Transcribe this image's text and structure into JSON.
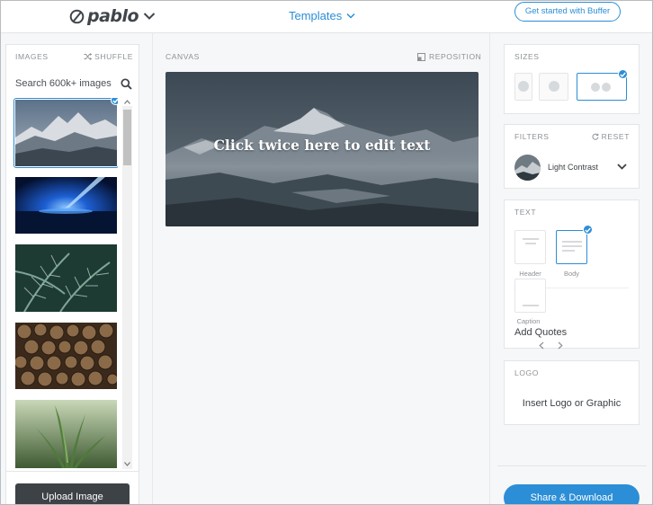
{
  "header": {
    "logo_text": "pablo",
    "templates_label": "Templates",
    "get_started_label": "Get started with Buffer"
  },
  "left_panel": {
    "images_label": "IMAGES",
    "shuffle_label": "SHUFFLE",
    "search_placeholder": "Search 600k+ images",
    "thumbnails": [
      {
        "subject": "snowy mountain peaks above clouds",
        "selected": true
      },
      {
        "subject": "blue light beam over dark horizon",
        "selected": false
      },
      {
        "subject": "green fern leaves",
        "selected": false
      },
      {
        "subject": "stacked cut firewood logs",
        "selected": false
      },
      {
        "subject": "green plant leaves close-up",
        "selected": false
      }
    ],
    "upload_label": "Upload Image"
  },
  "canvas": {
    "canvas_label": "CANVAS",
    "reposition_label": "REPOSITION",
    "overlay_text": "Click twice here to edit text"
  },
  "sizes": {
    "label": "SIZES",
    "options": [
      {
        "name": "pinterest",
        "selected": false
      },
      {
        "name": "instagram",
        "selected": false
      },
      {
        "name": "facebook-twitter",
        "selected": true
      }
    ]
  },
  "filters": {
    "label": "FILTERS",
    "reset_label": "RESET",
    "selected_filter": "Light Contrast"
  },
  "text": {
    "label": "TEXT",
    "styles": [
      {
        "label": "Header",
        "selected": false
      },
      {
        "label": "Body",
        "selected": true
      },
      {
        "label": "Caption",
        "selected": false
      }
    ],
    "add_quotes_label": "Add Quotes"
  },
  "logo": {
    "label": "LOGO",
    "insert_label": "Insert Logo or Graphic"
  },
  "share_label": "Share & Download",
  "colors": {
    "accent": "#2c8ed6",
    "dark_button": "#3d4247"
  }
}
